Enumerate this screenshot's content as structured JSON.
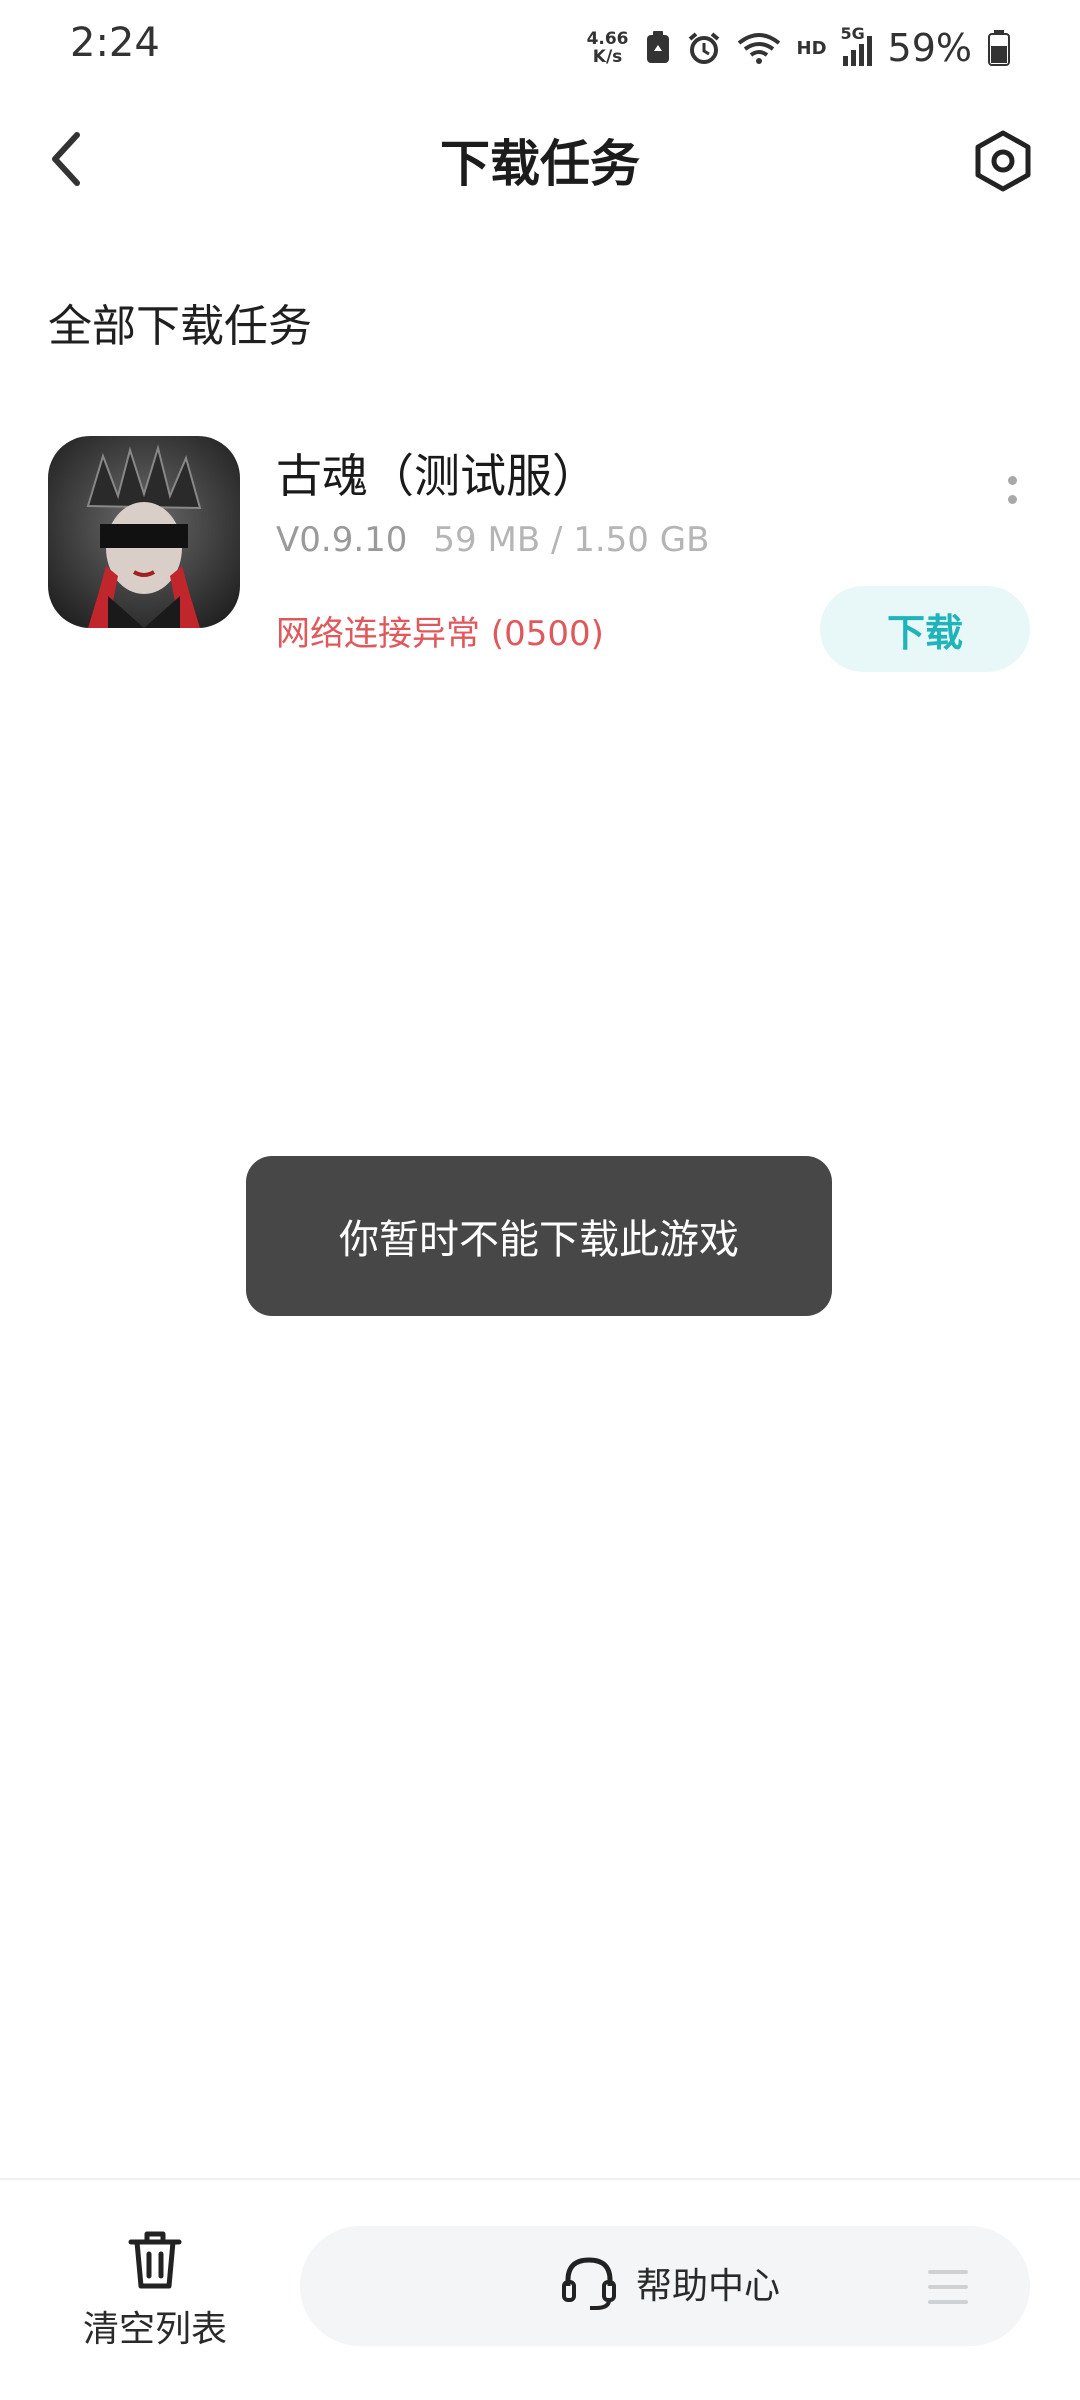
{
  "status_bar": {
    "time": "2:24",
    "speed_value": "4.66",
    "speed_unit": "K/s",
    "hd": "HD",
    "network": "5G",
    "battery": "59%"
  },
  "header": {
    "title": "下载任务",
    "back_icon": "chevron-left-icon",
    "settings_icon": "settings-icon"
  },
  "section": {
    "title": "全部下载任务"
  },
  "tasks": [
    {
      "name": "古魂（测试服）",
      "version": "V0.9.10",
      "size": "59 MB / 1.50 GB",
      "status": "网络连接异常 (0500)",
      "action_label": "下载"
    }
  ],
  "toast": {
    "message": "你暂时不能下载此游戏"
  },
  "bottom_bar": {
    "clear_label": "清空列表",
    "help_label": "帮助中心"
  },
  "colors": {
    "accent": "#1fb4b9",
    "error": "#e0585b",
    "toast_bg": "#474747"
  }
}
